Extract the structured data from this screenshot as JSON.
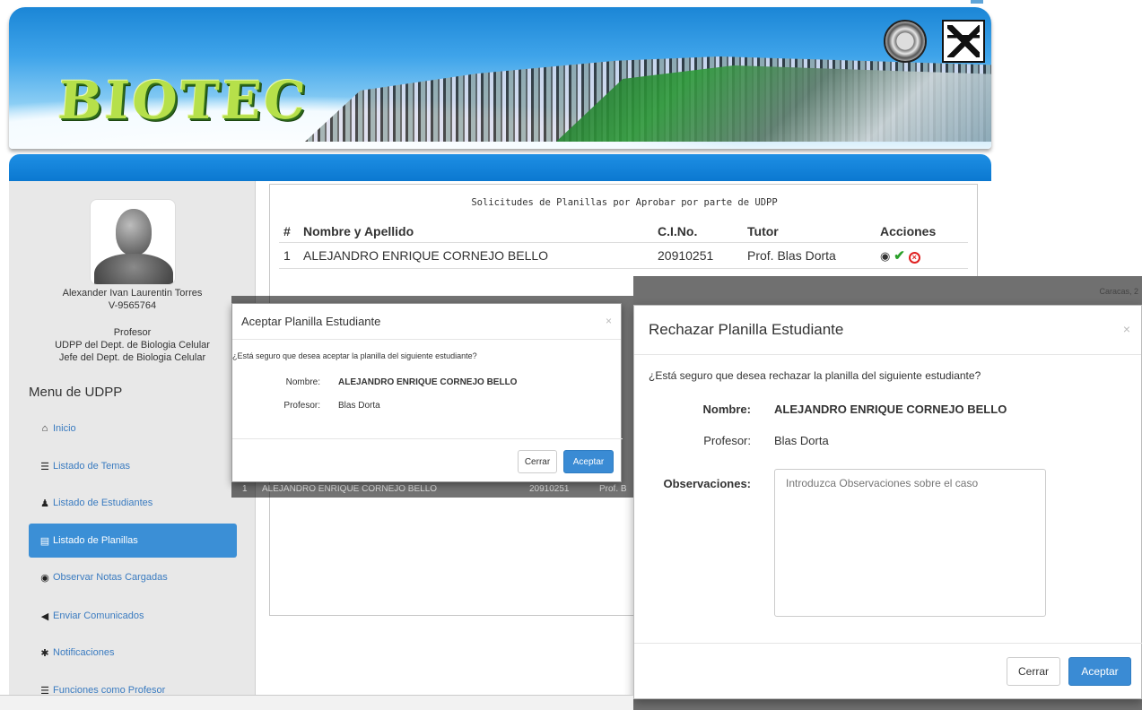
{
  "header": {
    "logo_text": "BIOTEC"
  },
  "profile": {
    "name": "Alexander Ivan Laurentin Torres",
    "id": "V-9565764",
    "role": "Profesor",
    "position1": "UDPP del Dept. de Biologia Celular",
    "position2": "Jefe del Dept. de Biologia Celular"
  },
  "sidebar": {
    "menu_title": "Menu de UDPP",
    "items": [
      {
        "label": "Inicio",
        "icon": "home-icon",
        "glyph": "🏠"
      },
      {
        "label": "Listado de Temas",
        "icon": "list-icon",
        "glyph": "☰"
      },
      {
        "label": "Listado de Estudiantes",
        "icon": "user-icon",
        "glyph": "👤"
      },
      {
        "label": "Listado de Planillas",
        "icon": "table-icon",
        "glyph": "▤"
      },
      {
        "label": "Observar Notas Cargadas",
        "icon": "eye-icon",
        "glyph": "◉"
      },
      {
        "label": "Enviar Comunicados",
        "icon": "bullhorn-icon",
        "glyph": "📢"
      },
      {
        "label": "Notificaciones",
        "icon": "asterisk-icon",
        "glyph": "✱"
      },
      {
        "label": "Funciones como Profesor",
        "icon": "list-alt-icon",
        "glyph": "☰"
      }
    ]
  },
  "main": {
    "panel_title": "Solicitudes de Planillas por Aprobar por parte de UDPP",
    "columns": [
      "#",
      "Nombre y Apellido",
      "C.I.No.",
      "Tutor",
      "Acciones"
    ],
    "rows": [
      {
        "num": "1",
        "name": "ALEJANDRO ENRIQUE CORNEJO BELLO",
        "ci": "20910251",
        "tutor": "Prof. Blas Dorta"
      }
    ],
    "background_row": {
      "num": "1",
      "name": "ALEJANDRO ENRIQUE CORNEJO BELLO",
      "ci": "20910251",
      "tutor": "Prof. B"
    }
  },
  "modal_accept": {
    "title": "Aceptar Planilla Estudiante",
    "close": "×",
    "question": "¿Está seguro que desea aceptar la planilla del siguiente estudiante?",
    "name_label": "Nombre:",
    "name_value": "ALEJANDRO ENRIQUE CORNEJO BELLO",
    "prof_label": "Profesor:",
    "prof_value": "Blas Dorta",
    "close_button": "Cerrar",
    "accept_button": "Aceptar"
  },
  "modal_reject": {
    "title": "Rechazar Planilla Estudiante",
    "close": "×",
    "question": "¿Está seguro que desea rechazar la planilla del siguiente estudiante?",
    "name_label": "Nombre:",
    "name_value": "ALEJANDRO ENRIQUE CORNEJO BELLO",
    "prof_label": "Profesor:",
    "prof_value": "Blas Dorta",
    "obs_label": "Observaciones:",
    "obs_placeholder": "Introduzca Observaciones sobre el caso",
    "close_button": "Cerrar",
    "accept_button": "Aceptar",
    "background_location": "Caracas, 2"
  },
  "colors": {
    "primary": "#3a8bd4",
    "navbar": "#0b78d0",
    "ok_green": "#2aa02a",
    "reject_red": "#e02020"
  }
}
